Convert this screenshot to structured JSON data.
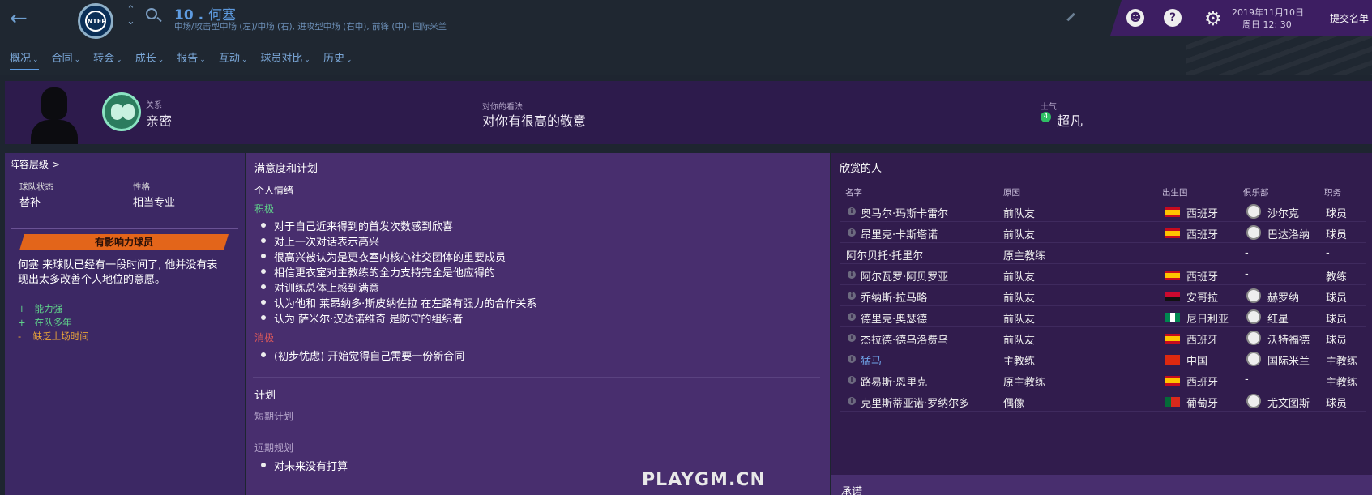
{
  "app": {
    "back_icon": "arrow-left-icon"
  },
  "player": {
    "number": "10 .",
    "name": "何塞",
    "positions": "中场/攻击型中场 (左)/中场 (右), 进攻型中场 (右中), 前锋 (中)- 国际米兰",
    "club_crest": "INTER"
  },
  "topbar": {
    "date": "2019年11月10日",
    "time": "周日 12: 30",
    "submit": "提交名单",
    "help": "?"
  },
  "tabs": [
    "概况",
    "合同",
    "转会",
    "成长",
    "报告",
    "互动",
    "球员对比",
    "历史"
  ],
  "header": {
    "relation_label": "关系",
    "relation_value": "亲密",
    "opinion_label": "对你的看法",
    "opinion_value": "对你有很高的敬意",
    "morale_label": "士气",
    "morale_value": "超凡",
    "morale_badge": "4"
  },
  "left": {
    "hierarchy": "阵容层级 >",
    "status_label": "球队状态",
    "status_value": "替补",
    "personality_label": "性格",
    "personality_value": "相当专业",
    "banner": "有影响力球员",
    "desc_line1": "何塞 来球队已经有一段时间了, 他并没有表",
    "desc_line2": "现出太多改善个人地位的意愿。",
    "factors": [
      {
        "sign": "+",
        "text": "能力强",
        "color": "#5fd08a"
      },
      {
        "sign": "+",
        "text": "在队多年",
        "color": "#5fd08a"
      },
      {
        "sign": "-",
        "text": "缺乏上场时间",
        "color": "#e8a43a"
      }
    ]
  },
  "middle": {
    "title": "满意度和计划",
    "mood_title": "个人情绪",
    "positive_label": "积极",
    "positives": [
      "对于自己近来得到的首发次数感到欣喜",
      "对上一次对话表示高兴",
      "很高兴被认为是更衣室内核心社交团体的重要成员",
      "相信更衣室对主教练的全力支持完全是他应得的",
      "对训练总体上感到满意",
      "认为他和 莱昂纳多·斯皮纳佐拉 在左路有强力的合作关系",
      "认为 萨米尔·汉达诺维奇 是防守的组织者"
    ],
    "negative_label": "消极",
    "negatives": [
      "(初步忧虑) 开始觉得自己需要一份新合同"
    ],
    "plans_title": "计划",
    "short_term": "短期计划",
    "long_term": "远期规划",
    "long_term_items": [
      "对未来没有打算"
    ]
  },
  "right": {
    "title": "欣赏的人",
    "columns": [
      "名字",
      "原因",
      "出生国",
      "俱乐部",
      "职务"
    ],
    "rows": [
      {
        "name": "奥马尔·玛斯卡雷尔",
        "reason": "前队友",
        "nation": "西班牙",
        "flag": "es",
        "club": "沙尔克",
        "role": "球员",
        "link": false,
        "info": true
      },
      {
        "name": "昂里克·卡斯塔诺",
        "reason": "前队友",
        "nation": "西班牙",
        "flag": "es",
        "club": "巴达洛纳",
        "role": "球员",
        "link": false,
        "info": true
      },
      {
        "name": "阿尔贝托·托里尔",
        "reason": "原主教练",
        "nation": "",
        "flag": "",
        "club": "-",
        "role": "-",
        "link": false,
        "info": false
      },
      {
        "name": "阿尔瓦罗·阿贝罗亚",
        "reason": "前队友",
        "nation": "西班牙",
        "flag": "es",
        "club": "-",
        "role": "教练",
        "link": false,
        "info": true
      },
      {
        "name": "乔纳斯·拉马略",
        "reason": "前队友",
        "nation": "安哥拉",
        "flag": "ao",
        "club": "赫罗纳",
        "role": "球员",
        "link": false,
        "info": true
      },
      {
        "name": "德里克·奥瑟德",
        "reason": "前队友",
        "nation": "尼日利亚",
        "flag": "ng",
        "club": "红星",
        "role": "球员",
        "link": false,
        "info": true
      },
      {
        "name": "杰拉德·德乌洛费乌",
        "reason": "前队友",
        "nation": "西班牙",
        "flag": "es",
        "club": "沃特福德",
        "role": "球员",
        "link": false,
        "info": true
      },
      {
        "name": "猛马",
        "reason": "主教练",
        "nation": "中国",
        "flag": "cn",
        "club": "国际米兰",
        "role": "主教练",
        "link": true,
        "info": true
      },
      {
        "name": "路易斯·恩里克",
        "reason": "原主教练",
        "nation": "西班牙",
        "flag": "es",
        "club": "-",
        "role": "主教练",
        "link": false,
        "info": true
      },
      {
        "name": "克里斯蒂亚诺·罗纳尔多",
        "reason": "偶像",
        "nation": "葡萄牙",
        "flag": "pt",
        "club": "尤文图斯",
        "role": "球员",
        "link": false,
        "info": true
      }
    ],
    "promises_title": "承诺"
  },
  "watermark": "PLAYGM.CN"
}
